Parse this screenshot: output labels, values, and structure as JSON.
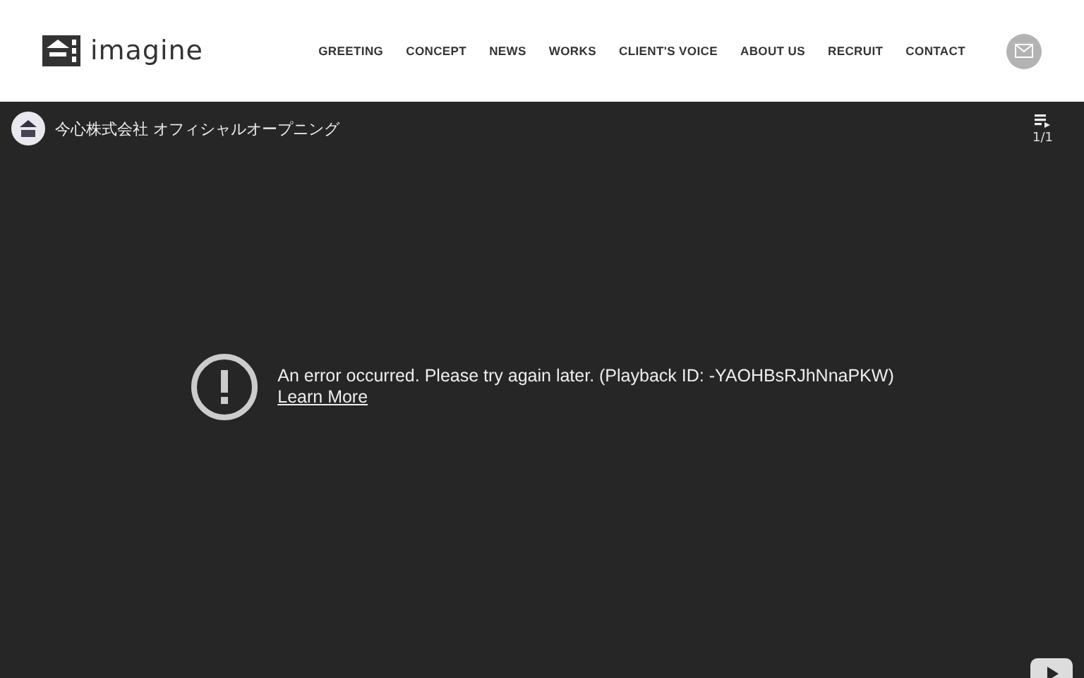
{
  "header": {
    "logo_text": "imagine",
    "nav": [
      {
        "label": "GREETING"
      },
      {
        "label": "CONCEPT"
      },
      {
        "label": "NEWS"
      },
      {
        "label": "WORKS"
      },
      {
        "label": "CLIENT'S VOICE"
      },
      {
        "label": "ABOUT US"
      },
      {
        "label": "RECRUIT"
      },
      {
        "label": "CONTACT"
      }
    ]
  },
  "video": {
    "title": "今心株式会社 オフィシャルオープニング",
    "playlist_count": "1/1",
    "error": "An error occurred. Please try again later. (Playback ID: -YAOHBsRJhNnaPKW)",
    "error_link": "Learn More"
  }
}
